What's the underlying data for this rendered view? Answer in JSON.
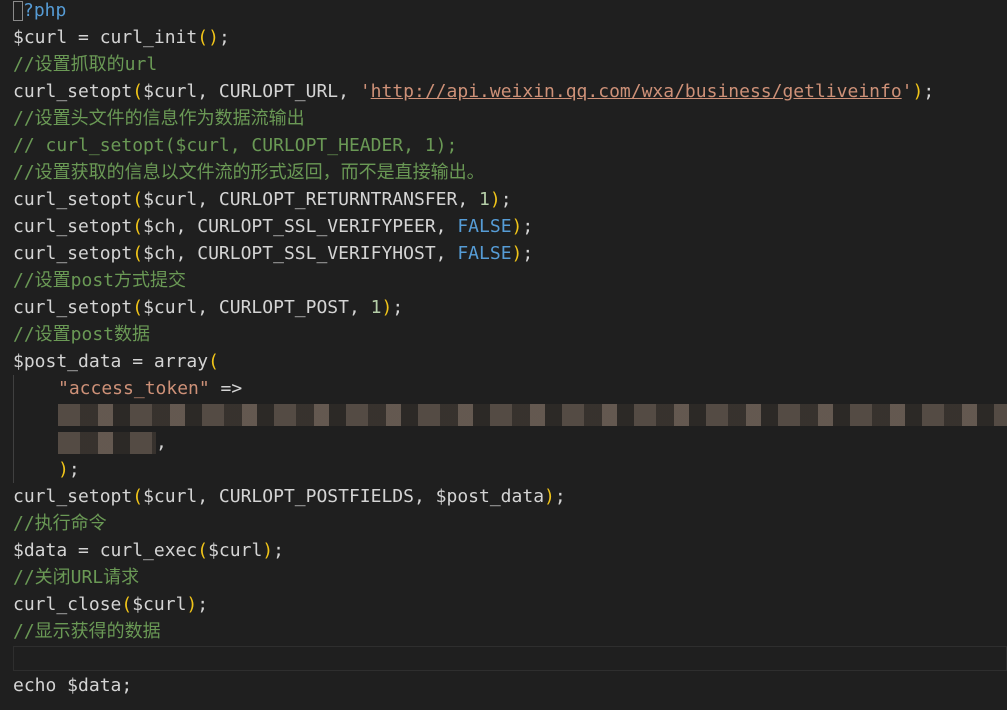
{
  "code": {
    "l1": "?php",
    "l2_var": "$curl",
    "l2_op": " = ",
    "l2_fn": "curl_init",
    "l2_end": ";",
    "l3": "//设置抓取的url",
    "l4_fn": "curl_setopt",
    "l4_args": "$curl, CURLOPT_URL, ",
    "l4_q1": "'",
    "l4_url": "http://api.weixin.qq.com/wxa/business/getliveinfo",
    "l4_q2": "'",
    "l4_end": ";",
    "l5": "//设置头文件的信息作为数据流输出",
    "l6": "// curl_setopt($curl, CURLOPT_HEADER, 1);",
    "l7": "//设置获取的信息以文件流的形式返回，而不是直接输出。",
    "l8_fn": "curl_setopt",
    "l8_args": "$curl, CURLOPT_RETURNTRANSFER, ",
    "l8_num": "1",
    "l8_end": ";",
    "l9_fn": "curl_setopt",
    "l9_args": "$ch, CURLOPT_SSL_VERIFYPEER, ",
    "l9_const": "FALSE",
    "l9_end": ";",
    "l10_fn": "curl_setopt",
    "l10_args": "$ch, CURLOPT_SSL_VERIFYHOST, ",
    "l10_const": "FALSE",
    "l10_end": ";",
    "l11": "//设置post方式提交",
    "l12_fn": "curl_setopt",
    "l12_args": "$curl, CURLOPT_POST, ",
    "l12_num": "1",
    "l12_end": ";",
    "l13": "//设置post数据",
    "l14_var": "$post_data",
    "l14_op": " = ",
    "l14_fn": "array",
    "l15_str": "\"access_token\"",
    "l15_op": " =>",
    "l17_comma": ",",
    "l18_end": ";",
    "l19_fn": "curl_setopt",
    "l19_args": "$curl, CURLOPT_POSTFIELDS, $post_data",
    "l19_end": ";",
    "l20": "//执行命令",
    "l21_var": "$data",
    "l21_op": " = ",
    "l21_fn": "curl_exec",
    "l21_args": "$curl",
    "l21_end": ";",
    "l22": "//关闭URL请求",
    "l23_fn": "curl_close",
    "l23_args": "$curl",
    "l23_end": ";",
    "l24": "//显示获得的数据",
    "l26": "echo $data;"
  },
  "colors": {
    "background": "#1f1f1f",
    "comment": "#6a9955",
    "string": "#ce9178",
    "keyword": "#569cd6",
    "number": "#b5cea8",
    "bracket": "#f0c419"
  }
}
